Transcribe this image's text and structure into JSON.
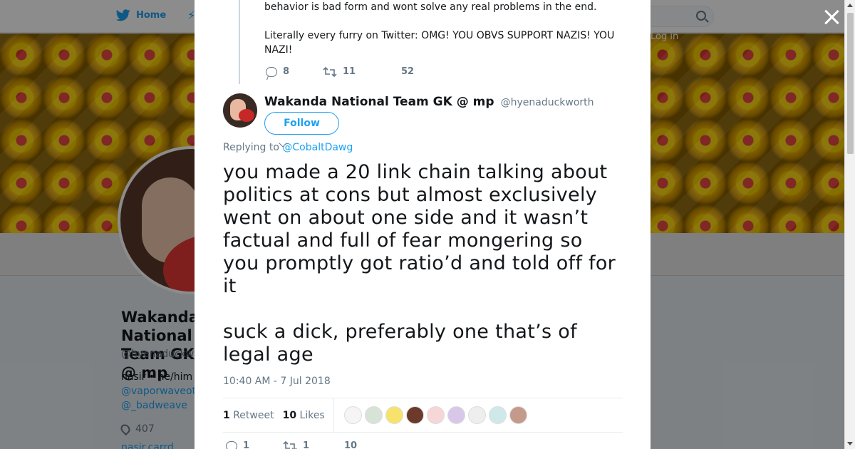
{
  "background": {
    "nav": {
      "home_label": "Home",
      "login_label": "Log in"
    },
    "profile": {
      "name": "Wakanda National Team GK @ mp",
      "handle": "@hyenaduckworth",
      "bio": "nasir • he/him",
      "link1": "@vaporwaveotter",
      "link2": "@_badweave",
      "location": "407",
      "link3": "nasir.carrd"
    }
  },
  "modal": {
    "close_label": "×",
    "parent_tweet": {
      "line1": "behavior is bad form and wont solve any real problems in the end.",
      "line2": "Literally every furry on Twitter: OMG! YOU OBVS SUPPORT NAZIS! YOU NAZI!",
      "replies": "8",
      "retweets": "11",
      "likes": "52"
    },
    "reply_tweet": {
      "display_name": "Wakanda National Team GK @ mp",
      "handle": "@hyenaduckworth",
      "follow_label": "Follow",
      "replying_prefix": "Replying to",
      "replying_to": "@CobaltDawg",
      "text_para1": "you made a 20 link chain talking about politics at cons but almost exclusively went on about one side and it wasn’t factual and full of fear mongering so you promptly got ratio’d and told off for it",
      "text_para2": "suck a dick, preferably one that’s of legal age",
      "timestamp": "10:40 AM - 7 Jul 2018",
      "retweet_count": "1",
      "retweet_label": "Retweet",
      "like_count": "10",
      "like_label": "Likes",
      "liker_colors": [
        "#f5f5f5",
        "#d8e3d8",
        "#f7e36b",
        "#6b3a2a",
        "#f6d6d6",
        "#d9c7ea",
        "#eeeeee",
        "#cfe8ea",
        "#c49a8a"
      ],
      "bottom_replies": "1",
      "bottom_retweets": "1",
      "bottom_likes": "10"
    }
  }
}
